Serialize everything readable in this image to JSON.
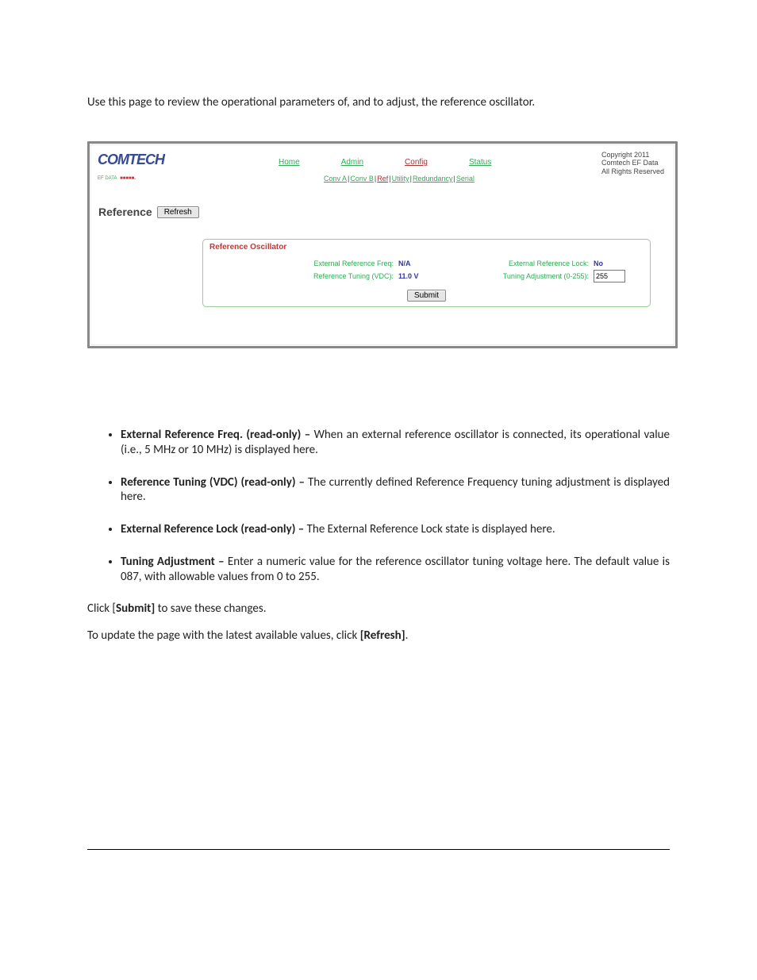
{
  "intro": "Use this page to review the operational parameters of, and to adjust, the reference oscillator.",
  "copyright": {
    "l1": "Copyright 2011",
    "l2": "Comtech EF Data",
    "l3": "All Rights Reserved"
  },
  "logo": {
    "brand_left": "C",
    "brand_rest": "OMTECH",
    "sub": "EF DATA",
    "red": "■■■■■."
  },
  "nav": {
    "items": [
      "Home",
      "Admin",
      "Config",
      "Status"
    ],
    "active_index": 2
  },
  "subnav": {
    "items": [
      "Conv A",
      "Conv B",
      "Ref",
      "Utility",
      "Redundancy",
      "Serial"
    ],
    "active_index": 2
  },
  "page_title": "Reference",
  "refresh_label": "Refresh",
  "panel": {
    "title": "Reference Oscillator",
    "ext_freq_label": "External Reference Freq:",
    "ext_freq_value": "N/A",
    "ref_tuning_label": "Reference Tuning (VDC):",
    "ref_tuning_value": "11.0 V",
    "ext_lock_label": "External Reference Lock:",
    "ext_lock_value": "No",
    "tuning_adj_label": "Tuning Adjustment (0-255):",
    "tuning_adj_value": "255",
    "submit_label": "Submit"
  },
  "bullets": {
    "b1_bold": "External Reference Freq. (read-only) – ",
    "b1_rest": "When an external reference oscillator is connected, its operational value (i.e., 5 MHz or 10 MHz) is displayed here.",
    "b2_bold": "Reference Tuning (VDC) (read-only) – ",
    "b2_rest": "The currently defined Reference Frequency tuning adjustment is displayed here.",
    "b3_bold": "External Reference Lock (read-only) – ",
    "b3_rest": "The External Reference Lock state is displayed here.",
    "b4_bold": "Tuning Adjustment – ",
    "b4_rest": "Enter a numeric value for the reference oscillator tuning voltage here. The default value is 087, with allowable values from 0 to 255."
  },
  "p1_a": "Click [",
  "p1_b": "Submit]",
  "p1_c": " to save these changes.",
  "p2_a": "To update the page with the latest available values, click ",
  "p2_b": "[Refresh]",
  "p2_c": "."
}
